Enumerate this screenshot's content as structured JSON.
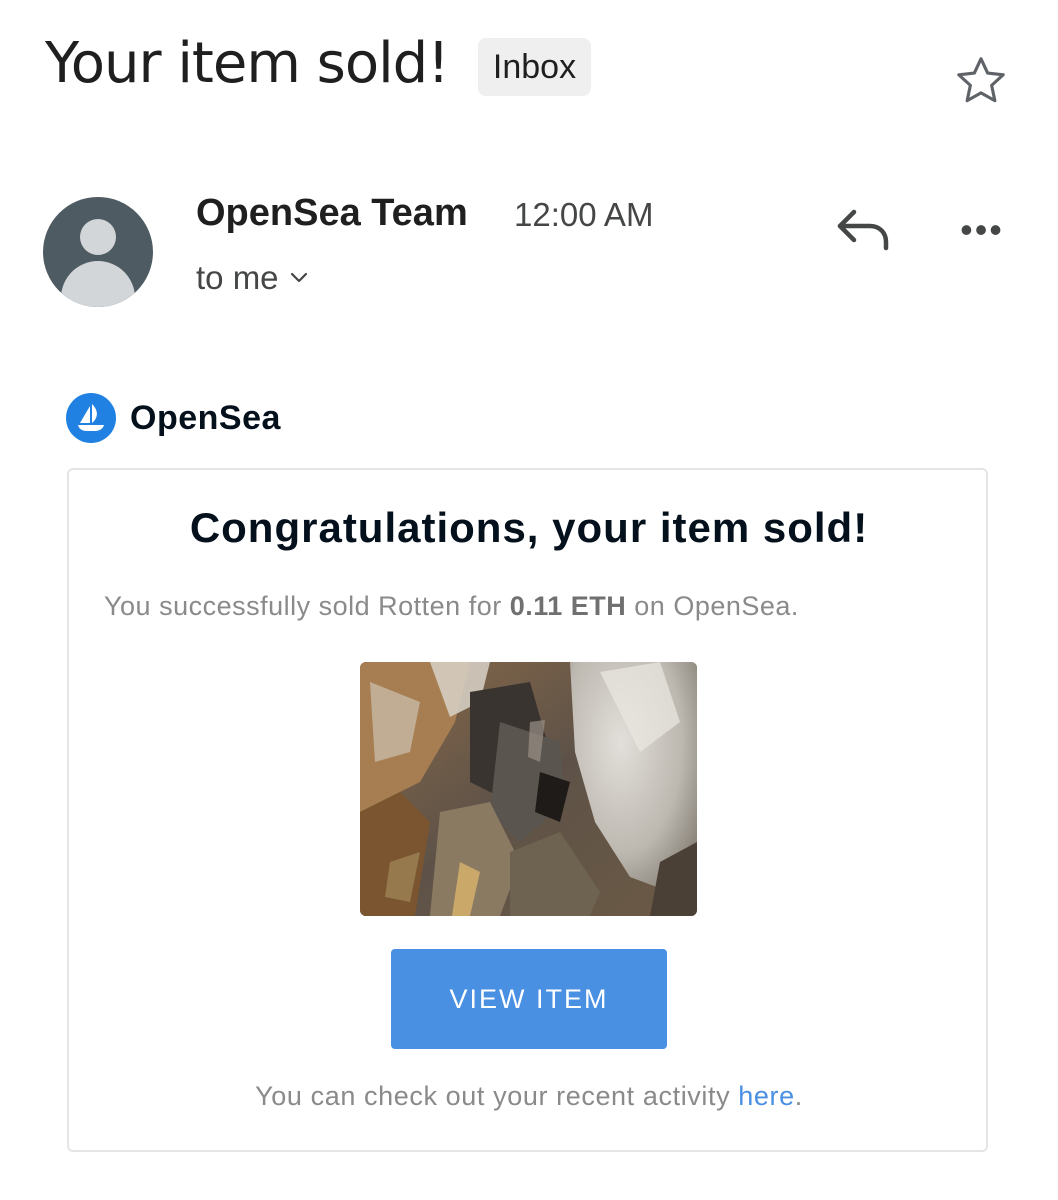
{
  "header": {
    "subject": "Your item sold!",
    "label": "Inbox",
    "star_icon": "star-icon"
  },
  "sender": {
    "name": "OpenSea Team",
    "time": "12:00 AM",
    "recipient": "to me",
    "avatar_icon": "person-icon",
    "reply_icon": "reply-icon",
    "more_icon": "more-horizontal-icon",
    "more_glyph": "•••"
  },
  "email": {
    "brand_name": "OpenSea",
    "brand_logo_icon": "opensea-boat-logo",
    "title": "Congratulations, your item sold!",
    "message_prefix": "You successfully sold Rotten for ",
    "price": "0.11 ETH",
    "message_suffix": " on OpenSea.",
    "button_label": "VIEW ITEM",
    "footer_prefix": "You can check out your recent activity ",
    "footer_link": "here",
    "footer_suffix": "."
  },
  "colors": {
    "accent": "#4a90e2",
    "brand_blue": "#2081e2",
    "avatar_bg": "#4f5b62"
  }
}
